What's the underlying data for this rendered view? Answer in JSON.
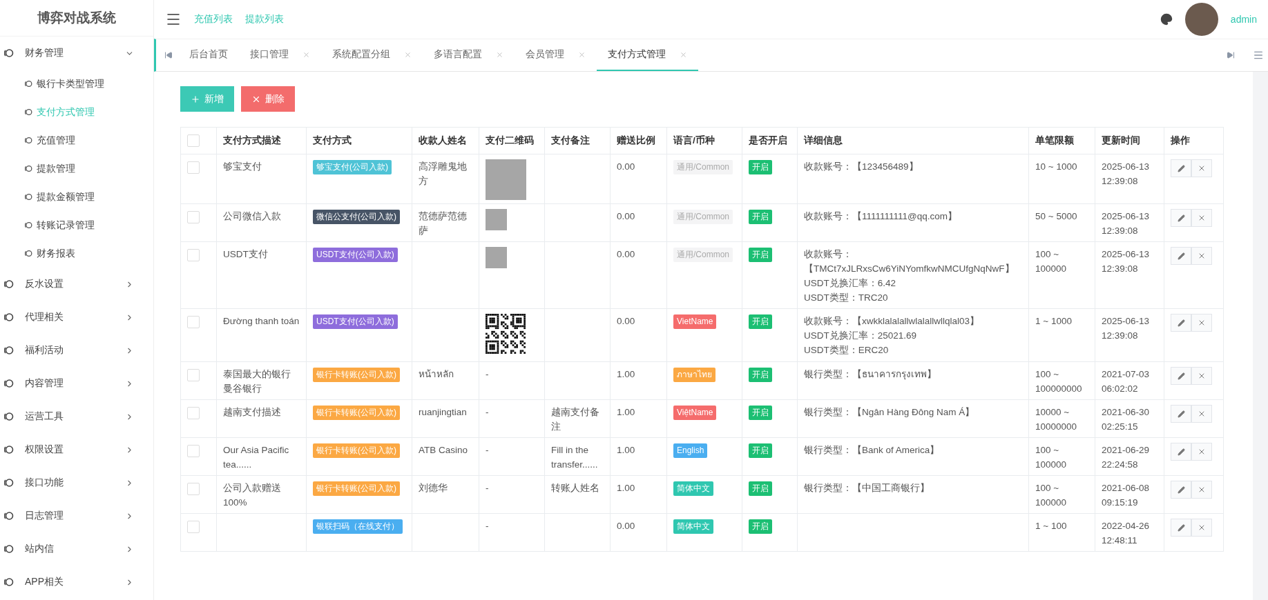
{
  "brand": "博弈对战系统",
  "top_links": [
    {
      "label": "充值列表"
    },
    {
      "label": "提款列表"
    }
  ],
  "user": {
    "name": "admin"
  },
  "sidebar": {
    "items": [
      {
        "label": "财务管理",
        "expanded": true,
        "children": [
          {
            "label": "银行卡类型管理",
            "selected": false
          },
          {
            "label": "支付方式管理",
            "selected": true
          },
          {
            "label": "充值管理",
            "selected": false
          },
          {
            "label": "提款管理",
            "selected": false
          },
          {
            "label": "提款金额管理",
            "selected": false
          },
          {
            "label": "转账记录管理",
            "selected": false
          },
          {
            "label": "财务报表",
            "selected": false
          }
        ]
      },
      {
        "label": "反水设置",
        "expanded": false
      },
      {
        "label": "代理相关",
        "expanded": false
      },
      {
        "label": "福利活动",
        "expanded": false
      },
      {
        "label": "内容管理",
        "expanded": false
      },
      {
        "label": "运营工具",
        "expanded": false
      },
      {
        "label": "权限设置",
        "expanded": false
      },
      {
        "label": "接口功能",
        "expanded": false
      },
      {
        "label": "日志管理",
        "expanded": false
      },
      {
        "label": "站内信",
        "expanded": false
      },
      {
        "label": "APP相关",
        "expanded": false
      }
    ]
  },
  "tabs": [
    {
      "label": "后台首页",
      "closable": false,
      "selected": false
    },
    {
      "label": "接口管理",
      "closable": true,
      "selected": false
    },
    {
      "label": "系统配置分组",
      "closable": true,
      "selected": false
    },
    {
      "label": "多语言配置",
      "closable": true,
      "selected": false
    },
    {
      "label": "会员管理",
      "closable": true,
      "selected": false
    },
    {
      "label": "支付方式管理",
      "closable": true,
      "selected": true
    }
  ],
  "toolbar": {
    "buttons": [
      {
        "label": "新增",
        "kind": "add"
      },
      {
        "label": "删除",
        "kind": "delete"
      }
    ]
  },
  "table": {
    "header_checked": false,
    "columns": [
      "支付方式描述",
      "支付方式",
      "收款人姓名",
      "支付二维码",
      "支付备注",
      "赠送比例",
      "语言/币种",
      "是否开启",
      "详细信息",
      "单笔限额",
      "更新时间",
      "操作"
    ],
    "rows": [
      {
        "checked": false,
        "description": "够宝支付",
        "method": {
          "label": "够宝支付(公司入款)",
          "color": "#4fc3d6"
        },
        "payee": "高浮雕鬼地方",
        "qr": {
          "kind": "photo"
        },
        "ratio": "0.00",
        "language": {
          "label": "通用/Common",
          "kind": "muted",
          "color": "#f4f4f5"
        },
        "enabled": {
          "label": "开启",
          "on": true
        },
        "details": [
          "收款账号：【123456489】"
        ],
        "limit": "10 ~ 1000",
        "updated": "2025-06-13 12:39:08"
      },
      {
        "checked": false,
        "description": "公司微信入款",
        "method": {
          "label": "微信公支付(公司入款)",
          "color": "#475466"
        },
        "payee": "范德萨范德萨",
        "qr": {
          "kind": "thumb"
        },
        "ratio": "0.00",
        "language": {
          "label": "通用/Common",
          "kind": "muted",
          "color": "#f4f4f5"
        },
        "enabled": {
          "label": "开启",
          "on": true
        },
        "details": [
          "收款账号：【1111111111@qq.com】"
        ],
        "limit": "50 ~ 5000",
        "updated": "2025-06-13 12:39:08"
      },
      {
        "checked": false,
        "description": "USDT支付",
        "method": {
          "label": "USDT支付(公司入款)",
          "color": "#8e6ddc"
        },
        "qr": {
          "kind": "thumb"
        },
        "ratio": "0.00",
        "language": {
          "label": "通用/Common",
          "kind": "muted",
          "color": "#f4f4f5"
        },
        "enabled": {
          "label": "开启",
          "on": true
        },
        "details": [
          "收款账号：【TMCt7xJLRxsCw6YiNYomfkwNMCUfgNqNwF】",
          "USDT兑换汇率：6.42",
          "USDT类型：TRC20"
        ],
        "limit": "100 ~ 100000",
        "updated": "2025-06-13 12:39:08"
      },
      {
        "checked": false,
        "description": "Đường thanh toán",
        "method": {
          "label": "USDT支付(公司入款)",
          "color": "#8e6ddc"
        },
        "qr": {
          "kind": "code"
        },
        "ratio": "0.00",
        "language": {
          "label": "VietName",
          "kind": "solid",
          "color": "#f56c6c"
        },
        "enabled": {
          "label": "开启",
          "on": true
        },
        "details": [
          "收款账号：【xwkklalalallwlalallwllqlal03】",
          "USDT兑换汇率：25021.69",
          "USDT类型：ERC20"
        ],
        "limit": "1 ~ 1000",
        "updated": "2025-06-13 12:39:08"
      },
      {
        "checked": false,
        "description": "泰国最大的银行曼谷银行",
        "method": {
          "label": "银行卡转账(公司入款)",
          "color": "#fba843"
        },
        "payee": "หน้าหลัก",
        "qr": {
          "kind": "text",
          "text": "-"
        },
        "ratio": "1.00",
        "language": {
          "label": "ภาษาไทย",
          "kind": "solid",
          "color": "#fba843"
        },
        "enabled": {
          "label": "开启",
          "on": true
        },
        "details": [
          "银行类型：【ธนาคารกรุงเทพ】"
        ],
        "limit": "100 ~ 100000000",
        "updated": "2021-07-03 06:02:02"
      },
      {
        "checked": false,
        "description": "越南支付描述",
        "method": {
          "label": "银行卡转账(公司入款)",
          "color": "#fba843"
        },
        "payee": "ruanjingtian",
        "qr": {
          "kind": "text",
          "text": "-"
        },
        "note": "越南支付备注",
        "ratio": "1.00",
        "language": {
          "label": "ViệtName",
          "kind": "solid",
          "color": "#f56c6c"
        },
        "enabled": {
          "label": "开启",
          "on": true
        },
        "details": [
          "银行类型：【Ngân Hàng Đông Nam Á】"
        ],
        "limit": "10000 ~ 10000000",
        "updated": "2021-06-30 02:25:15"
      },
      {
        "checked": false,
        "description": "Our Asia Pacific tea......",
        "method": {
          "label": "银行卡转账(公司入款)",
          "color": "#fba843"
        },
        "payee": "ATB Casino",
        "qr": {
          "kind": "text",
          "text": "-"
        },
        "note": "Fill in the transfer......",
        "ratio": "1.00",
        "language": {
          "label": "English",
          "kind": "solid",
          "color": "#4aaef0"
        },
        "enabled": {
          "label": "开启",
          "on": true
        },
        "details": [
          "银行类型：【Bank of America】"
        ],
        "limit": "100 ~ 100000",
        "updated": "2021-06-29 22:24:58"
      },
      {
        "checked": false,
        "description": "公司入款赠送100%",
        "method": {
          "label": "银行卡转账(公司入款)",
          "color": "#fba843"
        },
        "payee": "刘德华",
        "qr": {
          "kind": "text",
          "text": "-"
        },
        "note": "转账人姓名",
        "ratio": "1.00",
        "language": {
          "label": "简体中文",
          "kind": "solid",
          "color": "#2fc7b0"
        },
        "enabled": {
          "label": "开启",
          "on": true
        },
        "details": [
          "银行类型：【中国工商银行】"
        ],
        "limit": "100 ~ 100000",
        "updated": "2021-06-08 09:15:19"
      },
      {
        "checked": false,
        "method": {
          "label": "银联扫码（在线支付）",
          "color": "#4aaef0"
        },
        "qr": {
          "kind": "text",
          "text": "-"
        },
        "ratio": "0.00",
        "language": {
          "label": "简体中文",
          "kind": "solid",
          "color": "#2fc7b0"
        },
        "enabled": {
          "label": "开启",
          "on": true
        },
        "limit": "1 ~ 100",
        "updated": "2022-04-26 12:48:11"
      }
    ]
  }
}
